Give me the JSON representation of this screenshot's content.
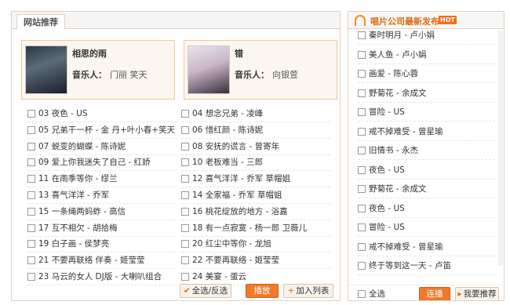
{
  "left": {
    "tab_label": "网站推荐",
    "featured": [
      {
        "title": "相思的雨",
        "artist_label": "音乐人：",
        "artist": "门丽 笑天"
      },
      {
        "title": "错",
        "artist_label": "音乐人：",
        "artist": "向银萱"
      }
    ],
    "songs": [
      [
        "03 夜色 - US",
        "04 想念兄弟 - 凌峰"
      ],
      [
        "05 兄弟干一杯 - 金 丹+叶小春+笑天",
        "06 惜红颜 - 陈诗妮"
      ],
      [
        "07 蜕变的蝴蝶 - 陈诗妮",
        "08 安抚的谎言 - 曾寄年"
      ],
      [
        "09 爱上你我迷失了自己 - 红娇",
        "10 老板难当 - 三郎"
      ],
      [
        "11 在雨季等你 - 缪兰",
        "12 喜气洋洋 - 乔军 草帽姐"
      ],
      [
        "13 喜气洋洋 - 乔军",
        "14 全家福 - 乔军 草帽姐"
      ],
      [
        "15 一条绳两蚂蚱 - 高信",
        "16 桃花绽放的地方 - 浴嘉"
      ],
      [
        "17 互不相欠 - 胡拾梅",
        "18 有一点寂寞 - 杨一郎 卫薇儿"
      ],
      [
        "19 白子画 - 侯梦亮",
        "20 红尘中等你 - 龙旭"
      ],
      [
        "21 不要再联络 伴奏 - 姬莹莹",
        "22 不要再联络 - 姬莹莹"
      ],
      [
        "23 马云的女人 DJ版 - 大喇叭组合",
        "24 美宴 - 蛋云"
      ]
    ],
    "buttons": {
      "select_all": "全选/反选",
      "play": "播放",
      "add_to_list": "加入列表"
    }
  },
  "right": {
    "title": "唱片公司最新发布",
    "badge": "HOT",
    "songs": [
      "秦时明月 - 卢小娟",
      "美人鱼 - 卢小娟",
      "画爱 - 陈心蓉",
      "野菊花 - 余成文",
      "冒险 - US",
      "戒不掉难受 - 曾星瑜",
      "旧情书 - 永杰",
      "夜色 - US",
      "野菊花 - 余成文",
      "夜色 - US",
      "冒险 - US",
      "戒不掉难受 - 曾星瑜",
      "终于等到这一天 - 卢笛"
    ],
    "footer": {
      "select_all": "全选",
      "play": "连播",
      "recommend": "我要推荐"
    }
  },
  "colors": {
    "accent": "#f07a2a",
    "border": "#e4d3bd",
    "title_orange": "#e26b12"
  }
}
